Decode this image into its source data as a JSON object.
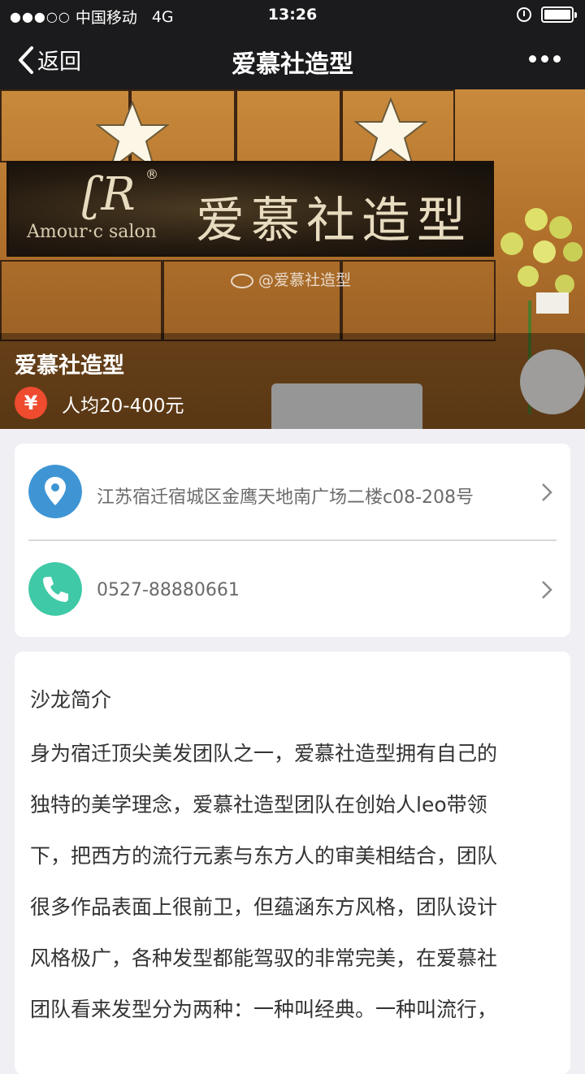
{
  "status_bar": {
    "signal": "●●●○○",
    "carrier": "中国移动",
    "network": "4G",
    "time": "13:26"
  },
  "nav": {
    "back_label": "返回",
    "title": "爱慕社造型"
  },
  "hero": {
    "sign_chinese": "爱慕社造型",
    "sign_english": "Amour·c salon",
    "watermark": "@爱慕社造型",
    "name": "爱慕社造型",
    "price_symbol": "¥",
    "price": "人均20-400元"
  },
  "contact": {
    "address": "江苏宿迁宿城区金鹰天地南广场二楼c08-208号",
    "phone": "0527-88880661"
  },
  "intro": {
    "title": "沙龙简介",
    "lines": [
      "身为宿迁顶尖美发团队之一，爱慕社造型拥有自己的",
      "独特的美学理念，爱慕社造型团队在创始人leo带领",
      "下，把西方的流行元素与东方人的审美相结合，团队",
      "很多作品表面上很前卫，但蕴涵东方风格，团队设计",
      "风格极广，各种发型都能驾驭的非常完美，在爱慕社",
      "团队看来发型分为两种：一种叫经典。一种叫流行，"
    ]
  },
  "colors": {
    "nav_bg": "#1b1b1d",
    "location_icon": "#3f95d4",
    "phone_icon": "#3fc9a6",
    "price_icon": "#ee4b2f"
  },
  "icons": [
    "back-chevron-icon",
    "more-icon",
    "alarm-icon",
    "battery-icon",
    "yen-icon",
    "location-pin-icon",
    "phone-icon",
    "chevron-right-icon"
  ]
}
